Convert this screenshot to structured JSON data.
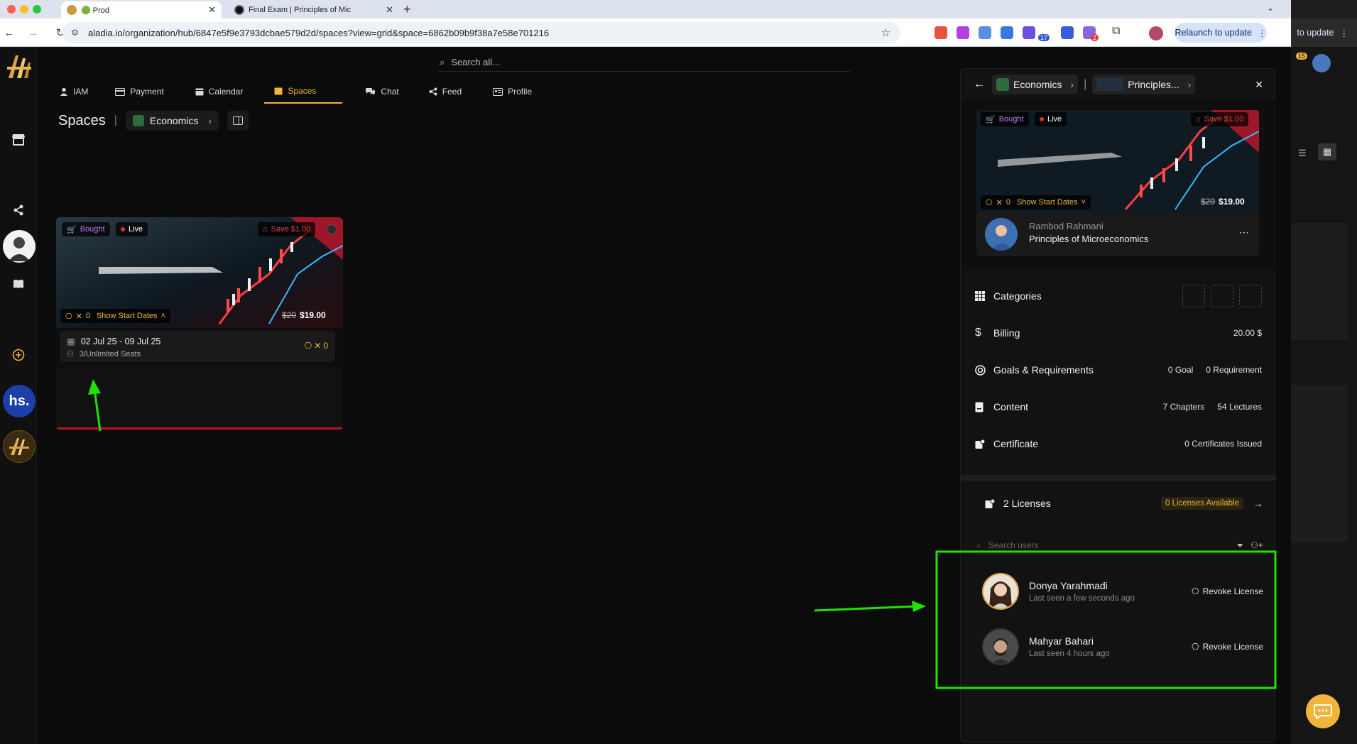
{
  "browser": {
    "tabs": [
      {
        "title": "🟢 Prod"
      },
      {
        "title": "Final Exam | Principles of Mic"
      }
    ],
    "url": "aladia.io/organization/hub/6847e5f9e3793dcbae579d2d/spaces?view=grid&space=6862b09b9f38a7e58e701216",
    "relaunch_label": "Relaunch to update",
    "side_relaunch_label": "to update",
    "ext_badge_count": "17",
    "ext_badge_count2": "2",
    "side_badge": "15"
  },
  "app": {
    "search_placeholder": "Search all...",
    "nav": [
      {
        "label": "IAM",
        "icon": "user-icon"
      },
      {
        "label": "Payment",
        "icon": "card-icon"
      },
      {
        "label": "Calendar",
        "icon": "calendar-icon"
      },
      {
        "label": "Spaces",
        "icon": "spaces-icon",
        "active": true
      },
      {
        "label": "Chat",
        "icon": "chat-icon"
      },
      {
        "label": "Feed",
        "icon": "share-icon"
      },
      {
        "label": "Profile",
        "icon": "profile-icon"
      }
    ],
    "rail": {
      "hs_label": "hs."
    },
    "spaces_title": "Spaces",
    "breadcrumb_space": "Economics",
    "accent": "#f0b53a",
    "card": {
      "bought": "Bought",
      "live": "Live",
      "save": "Save $1.00",
      "counter": "0",
      "show_start_dates": "Show Start Dates",
      "old_price": "$20",
      "price": "$19.00",
      "date_range": "02 Jul 25 - 09 Jul 25",
      "seats": "3/Unlimited Seats",
      "date_counter": "0"
    }
  },
  "panel": {
    "crumb_space": "Economics",
    "crumb_course": "Principles...",
    "card": {
      "bought": "Bought",
      "live": "Live",
      "save": "Save $1.00",
      "counter": "0",
      "show_start_dates": "Show Start Dates",
      "old_price": "$20",
      "price": "$19.00"
    },
    "author_name": "Rambod Rahmani",
    "course_title": "Principles of Microeconomics",
    "rows": {
      "categories": "Categories",
      "billing": "Billing",
      "billing_value": "20.00 $",
      "goals": "Goals & Requirements",
      "goals_value1": "0 Goal",
      "goals_value2": "0 Requirement",
      "content": "Content",
      "content_value1": "7 Chapters",
      "content_value2": "54 Lectures",
      "certificate": "Certificate",
      "certificate_value": "0 Certificates Issued"
    },
    "licenses": {
      "title": "2 Licenses",
      "available": "0 Licenses Available",
      "search_placeholder": "Search users",
      "users": [
        {
          "name": "Donya Yarahmadi",
          "last_seen": "Last seen a few seconds ago",
          "action": "Revoke License"
        },
        {
          "name": "Mahyar Bahari",
          "last_seen": "Last seen 4 hours ago",
          "action": "Revoke License"
        }
      ]
    }
  },
  "annotations": {
    "highlight_color": "#22e000"
  }
}
